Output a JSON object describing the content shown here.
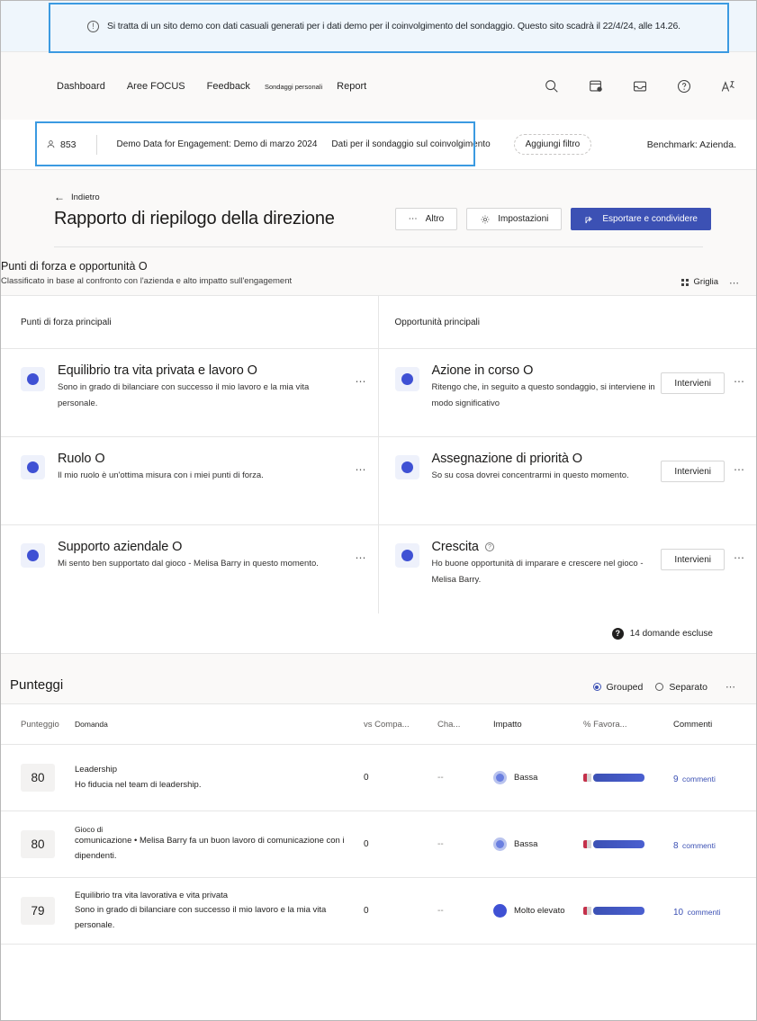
{
  "banner": {
    "icon": "info-icon",
    "text": "Si tratta di un sito demo con dati casuali generati per i dati demo per il coinvolgimento del sondaggio. Questo sito scadrà il 22/4/24, alle 14.26."
  },
  "topnav": {
    "links": [
      {
        "label": "Dashboard",
        "small": false
      },
      {
        "label": "Aree FOCUS",
        "small": false
      },
      {
        "label": "Feedback",
        "small": false
      },
      {
        "label": "Sondaggi personali",
        "small": true
      },
      {
        "label": "Report",
        "small": false
      }
    ],
    "icons": [
      "search-icon",
      "window-settings-icon",
      "inbox-icon",
      "help-icon",
      "translate-icon"
    ]
  },
  "filterbar": {
    "respondents": "853",
    "chips": [
      "Demo Data for Engagement: Demo di marzo 2024",
      "Dati per il sondaggio sul coinvolgimento"
    ],
    "add_filter": "Aggiungi filtro",
    "benchmark": "Benchmark: Azienda."
  },
  "report": {
    "back": "Indietro",
    "title": "Rapporto di riepilogo della direzione",
    "buttons": {
      "more": "Altro",
      "settings": "Impostazioni",
      "export": "Esportare e condividere"
    }
  },
  "strengths": {
    "title": "Punti di forza e opportunità O",
    "subtitle": "Classificato in base al confronto con l'azienda e alto impatto sull'engagement",
    "view_toggle": "Griglia",
    "left_header": "Punti di forza principali",
    "right_header": "Opportunità principali",
    "left_items": [
      {
        "title": "Equilibrio tra vita privata e lavoro O",
        "desc": "Sono in grado di bilanciare con successo il mio lavoro e la mia vita personale.",
        "has_info": false,
        "action": null
      },
      {
        "title": "Ruolo O",
        "desc": "Il mio ruolo è un'ottima misura con i miei punti di forza.",
        "has_info": false,
        "action": null
      },
      {
        "title": "Supporto aziendale O",
        "desc": "Mi sento ben supportato dal gioco - Melisa Barry in questo momento.",
        "has_info": false,
        "action": null
      }
    ],
    "right_items": [
      {
        "title": "Azione in corso O",
        "desc": "Ritengo che, in seguito a questo sondaggio, si interviene in modo significativo",
        "has_info": false,
        "action": "Intervieni"
      },
      {
        "title": "Assegnazione di priorità O",
        "desc": "So su cosa dovrei concentrarmi in questo momento.",
        "has_info": false,
        "action": "Intervieni"
      },
      {
        "title": "Crescita",
        "desc": "Ho buone opportunità di imparare e crescere nel gioco - Melisa Barry.",
        "has_info": true,
        "action": "Intervieni"
      }
    ],
    "excluded": "14 domande escluse"
  },
  "scores": {
    "title": "Punteggi",
    "group_option": "Grouped",
    "separate_option": "Separato",
    "selected_option": "Grouped",
    "columns": {
      "score": "Punteggio",
      "question": "Domanda",
      "vs_company": "vs Compa...",
      "change": "Cha...",
      "impact": "Impatto",
      "favorable": "% Favora...",
      "comments": "Commenti"
    },
    "rows": [
      {
        "score": "80",
        "category": "Leadership",
        "question": "Ho fiducia nel team di leadership.",
        "vs_company": "0",
        "change": "--",
        "impact": "Bassa",
        "impact_level": "low",
        "comments_count": "9",
        "comments_label": "commenti",
        "favorable": {
          "red": 4,
          "gray": 5,
          "blue": 40
        }
      },
      {
        "score": "80",
        "category": "Gioco di",
        "question": "comunicazione • Melisa Barry fa un buon lavoro di comunicazione con i dipendenti.",
        "vs_company": "0",
        "change": "--",
        "impact": "Bassa",
        "impact_level": "low",
        "comments_count": "8",
        "comments_label": "commenti",
        "favorable": {
          "red": 4,
          "gray": 5,
          "blue": 40
        }
      },
      {
        "score": "79",
        "category": "Equilibrio tra vita lavorativa e vita privata",
        "question": "Sono in grado di bilanciare con successo il mio lavoro e la mia vita personale.",
        "vs_company": "0",
        "change": "--",
        "impact": "Molto elevato",
        "impact_level": "high",
        "comments_count": "10",
        "comments_label": "commenti",
        "favorable": {
          "red": 4,
          "gray": 5,
          "blue": 40
        }
      }
    ]
  },
  "colors": {
    "accent": "#3c51b4",
    "banner_bg": "#eff6fc",
    "highlight": "#3b9ae1",
    "chrome_bg": "#faf9f8",
    "bar_red": "#c4314b"
  }
}
